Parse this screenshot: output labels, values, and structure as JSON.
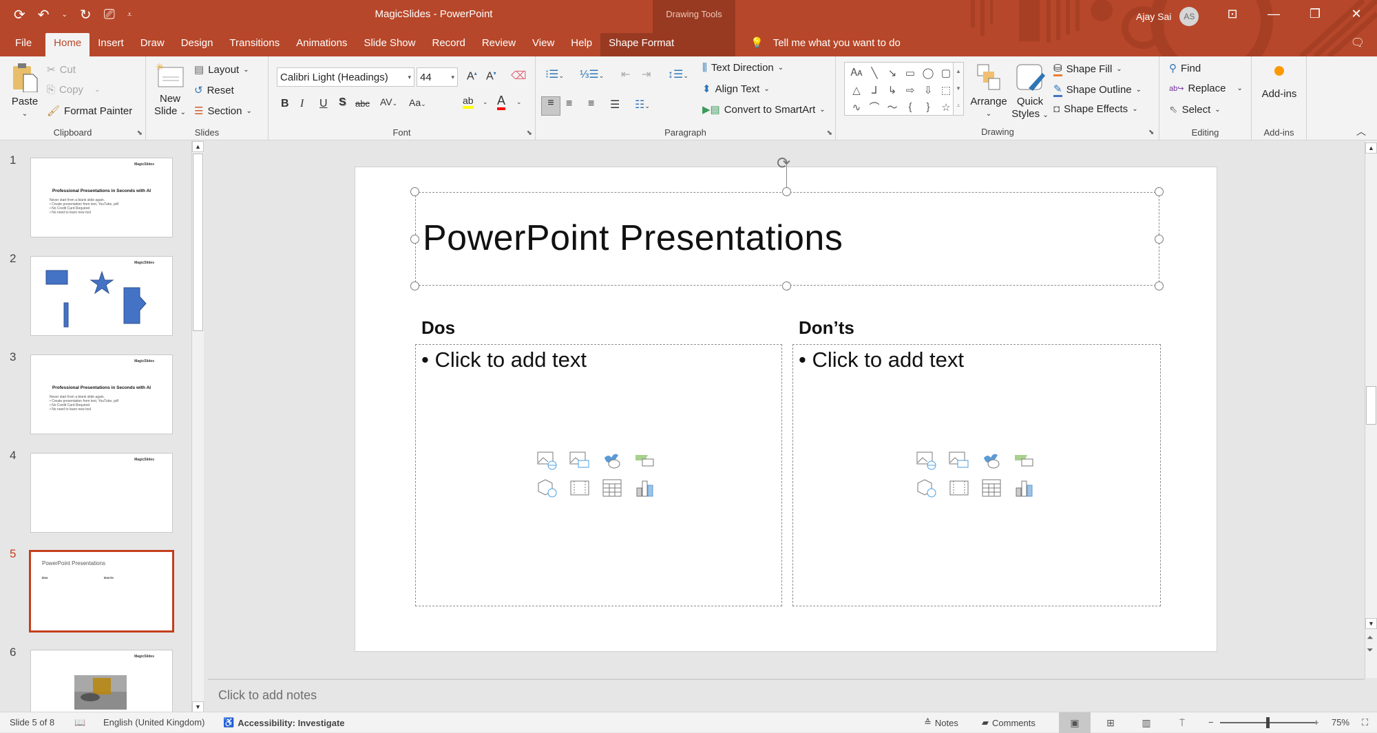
{
  "window": {
    "title": "MagicSlides  -  PowerPoint",
    "context_tab_group": "Drawing Tools",
    "user_name": "Ajay Sai",
    "user_initials": "AS",
    "accent_color": "#b7472a"
  },
  "quick_access": [
    "autosave-icon",
    "undo-icon",
    "redo-icon",
    "start-from-beginning-icon",
    "customize-qat-icon"
  ],
  "tabs": [
    {
      "label": "File"
    },
    {
      "label": "Home",
      "active": true
    },
    {
      "label": "Insert"
    },
    {
      "label": "Draw"
    },
    {
      "label": "Design"
    },
    {
      "label": "Transitions"
    },
    {
      "label": "Animations"
    },
    {
      "label": "Slide Show"
    },
    {
      "label": "Record"
    },
    {
      "label": "Review"
    },
    {
      "label": "View"
    },
    {
      "label": "Help"
    },
    {
      "label": "Shape Format",
      "contextual": true
    }
  ],
  "tell_me": "Tell me what you want to do",
  "ribbon": {
    "clipboard": {
      "label": "Clipboard",
      "paste": "Paste",
      "cut": "Cut",
      "copy": "Copy",
      "format_painter": "Format Painter"
    },
    "slides": {
      "label": "Slides",
      "new_slide_1": "New",
      "new_slide_2": "Slide",
      "layout": "Layout",
      "reset": "Reset",
      "section": "Section"
    },
    "font": {
      "label": "Font",
      "font_name": "Calibri Light (Headings)",
      "font_size": "44",
      "highlight_color": "#ffff00",
      "font_color": "#ff0000"
    },
    "paragraph": {
      "label": "Paragraph",
      "text_direction": "Text Direction",
      "align_text": "Align Text",
      "convert_smartart": "Convert to SmartArt"
    },
    "drawing": {
      "label": "Drawing",
      "arrange": "Arrange",
      "quick_styles_1": "Quick",
      "quick_styles_2": "Styles",
      "shape_fill": "Shape Fill",
      "shape_outline": "Shape Outline",
      "shape_effects": "Shape Effects"
    },
    "editing": {
      "label": "Editing",
      "find": "Find",
      "replace": "Replace",
      "select": "Select"
    },
    "addins": {
      "label": "Add-ins",
      "button": "Add-ins"
    }
  },
  "thumbnails": [
    {
      "num": "1",
      "logo": "MagicSlides",
      "title": "Professional Presentations in Seconds with AI",
      "body": [
        "Never start from a blank slide again.",
        "• Create presentation from text, YouTube, pdf",
        "• No Credit Card Required",
        "• No need to learn new tool"
      ]
    },
    {
      "num": "2",
      "logo": "MagicSlides"
    },
    {
      "num": "3",
      "logo": "MagicSlides",
      "title": "Professional Presentations in Seconds with AI",
      "body": [
        "Never start from a blank slide again.",
        "• Create presentation from text, YouTube, pdf",
        "• No Credit Card Required",
        "• No need to learn new tool"
      ]
    },
    {
      "num": "4",
      "logo": "MagicSlides"
    },
    {
      "num": "5",
      "selected": true,
      "title": "PowerPoint Presentations",
      "col1": "Dos",
      "col2": "Don'ts"
    },
    {
      "num": "6",
      "logo": "MagicSlides"
    }
  ],
  "slide": {
    "title": "PowerPoint Presentations",
    "left_heading": "Dos",
    "right_heading": "Don’ts",
    "left_placeholder": "Click to add text",
    "right_placeholder": "Click to add text",
    "insert_icons": [
      "insert-online-picture-icon",
      "insert-picture-icon",
      "insert-icons-icon",
      "insert-smartart-icon",
      "insert-3d-model-icon",
      "insert-video-icon",
      "insert-table-icon",
      "insert-chart-icon"
    ]
  },
  "notes_placeholder": "Click to add notes",
  "status": {
    "slide_counter": "Slide 5 of 8",
    "language": "English (United Kingdom)",
    "accessibility": "Accessibility: Investigate",
    "notes": "Notes",
    "comments": "Comments",
    "zoom": "75%",
    "zoom_fraction": 0.5
  }
}
